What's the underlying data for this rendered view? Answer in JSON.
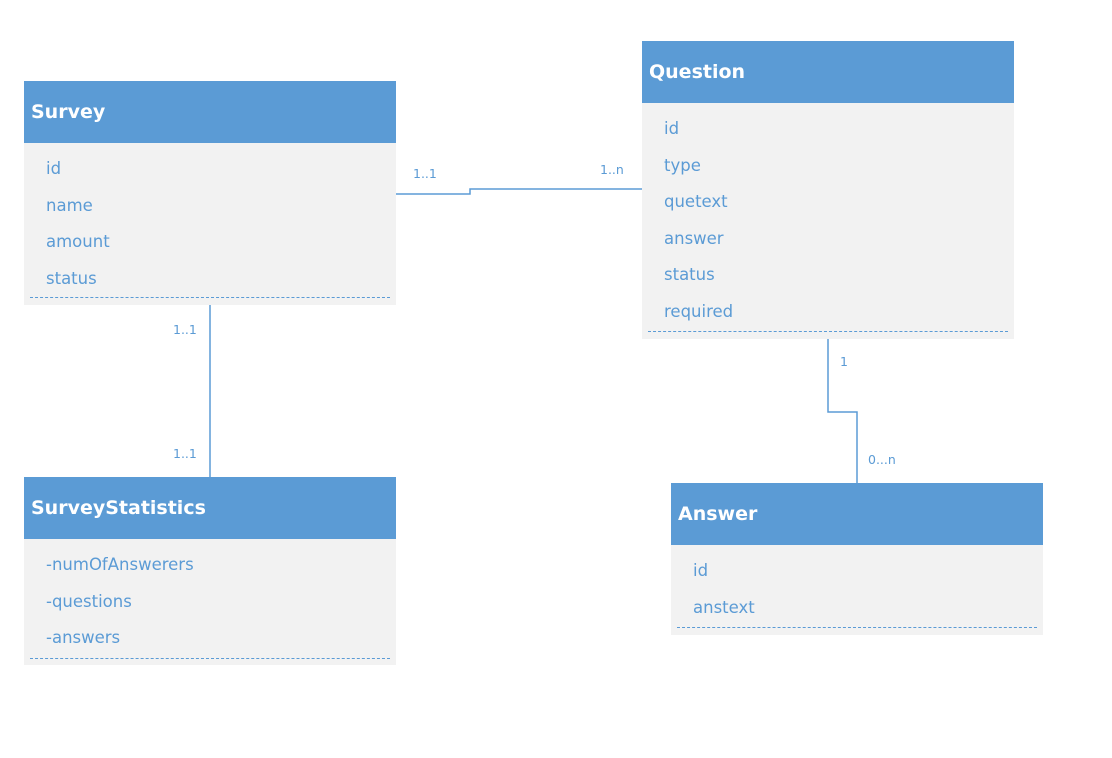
{
  "entities": {
    "survey": {
      "title": "Survey",
      "attributes": [
        "id",
        "name",
        "amount",
        "status"
      ]
    },
    "question": {
      "title": "Question",
      "attributes": [
        "id",
        "type",
        "quetext",
        "answer",
        "status",
        "required"
      ]
    },
    "survey_statistics": {
      "title": "SurveyStatistics",
      "attributes": [
        "-numOfAnswerers",
        "-questions",
        "-answers"
      ]
    },
    "answer": {
      "title": "Answer",
      "attributes": [
        "id",
        "anstext"
      ]
    }
  },
  "relationships": {
    "survey_question": {
      "from": "1..1",
      "to": "1..n"
    },
    "survey_stats": {
      "from": "1..1",
      "to": "1..1"
    },
    "question_answer": {
      "from": "1",
      "to": "0...n"
    }
  },
  "colors": {
    "header": "#5b9bd5",
    "body": "#f2f2f2",
    "text": "#5b9bd5",
    "header_text": "#ffffff"
  }
}
